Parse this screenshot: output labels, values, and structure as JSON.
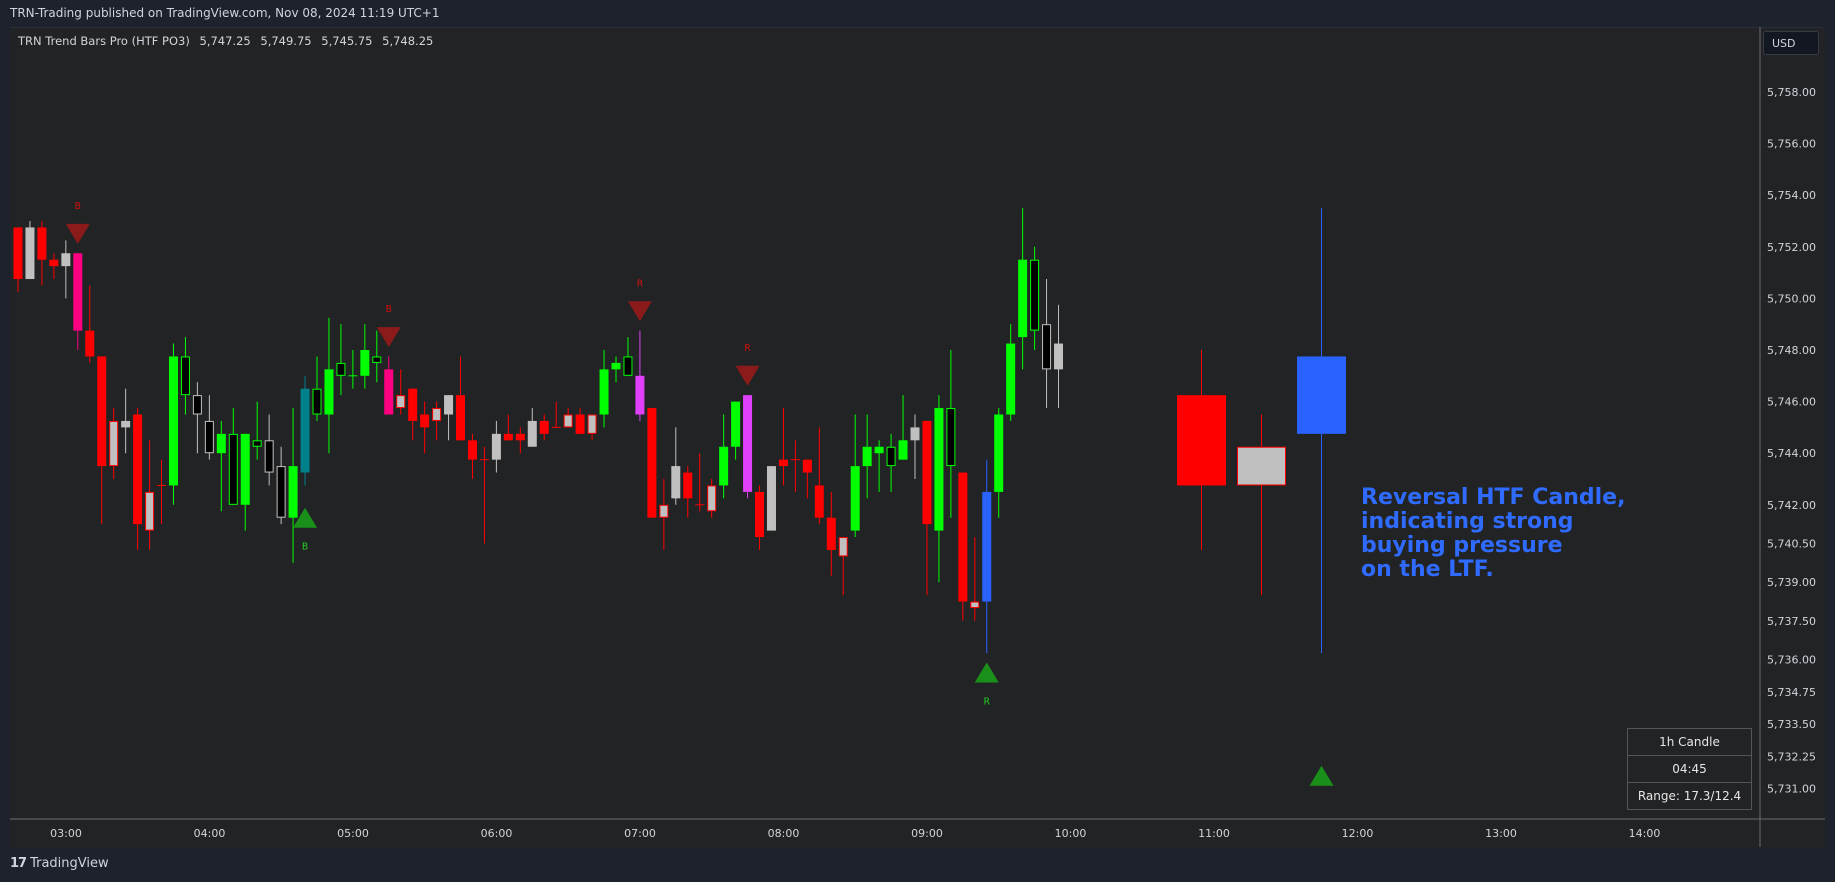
{
  "header": {
    "published": "TRN-Trading published on TradingView.com, Nov 08, 2024 11:19 UTC+1"
  },
  "legend": {
    "indicator": "TRN Trend Bars Pro (HTF PO3)",
    "values": [
      "5,747.25",
      "5,749.75",
      "5,745.75",
      "5,748.25"
    ]
  },
  "price_axis": {
    "currency": "USD",
    "ticks": [
      "5,758.00",
      "5,756.00",
      "5,754.00",
      "5,752.00",
      "5,750.00",
      "5,748.00",
      "5,746.00",
      "5,744.00",
      "5,742.00",
      "5,740.50",
      "5,739.00",
      "5,737.50",
      "5,736.00",
      "5,734.75",
      "5,733.50",
      "5,732.25",
      "5,731.00"
    ]
  },
  "time_axis": {
    "ticks": [
      "03:00",
      "04:00",
      "05:00",
      "06:00",
      "07:00",
      "08:00",
      "09:00",
      "10:00",
      "11:00",
      "12:00",
      "13:00",
      "14:00"
    ]
  },
  "colors": {
    "red": "#ff0000",
    "green": "#00ff00",
    "gray": "#c0c0c0",
    "pink": "#ff0080",
    "magenta": "#e040fb",
    "teal": "#00808a",
    "blue": "#2962ff",
    "signal_down": "#8b1a1a",
    "signal_up": "#1a8f1a",
    "label_down": "#cc1111",
    "label_up": "#22cc22",
    "annotation": "#2f6bff"
  },
  "chart_data": {
    "type": "candlestick",
    "title": "TRN Trend Bars Pro (HTF PO3)",
    "ylim": [
      5730.5,
      5758.5
    ],
    "x_ticks": [
      "03:00",
      "04:00",
      "05:00",
      "06:00",
      "07:00",
      "08:00",
      "09:00",
      "10:00",
      "11:00",
      "12:00",
      "13:00",
      "14:00"
    ],
    "candles": [
      {
        "o": 5752.75,
        "h": 5752.75,
        "l": 5750.25,
        "c": 5750.75,
        "s": "red"
      },
      {
        "o": 5750.75,
        "h": 5753.0,
        "l": 5750.75,
        "c": 5752.75,
        "s": "gray"
      },
      {
        "o": 5752.75,
        "h": 5753.0,
        "l": 5750.5,
        "c": 5751.5,
        "s": "red"
      },
      {
        "o": 5751.5,
        "h": 5751.75,
        "l": 5750.75,
        "c": 5751.25,
        "s": "red"
      },
      {
        "o": 5751.25,
        "h": 5752.25,
        "l": 5750.0,
        "c": 5751.75,
        "s": "gray"
      },
      {
        "o": 5751.75,
        "h": 5751.75,
        "l": 5748.0,
        "c": 5748.75,
        "s": "pink"
      },
      {
        "o": 5748.75,
        "h": 5750.5,
        "l": 5747.5,
        "c": 5747.75,
        "s": "red"
      },
      {
        "o": 5747.75,
        "h": 5747.75,
        "l": 5741.25,
        "c": 5743.5,
        "s": "red"
      },
      {
        "o": 5743.5,
        "h": 5745.75,
        "l": 5743.0,
        "c": 5745.25,
        "s": "gray-r"
      },
      {
        "o": 5745.0,
        "h": 5746.5,
        "l": 5744.0,
        "c": 5745.25,
        "s": "gray"
      },
      {
        "o": 5745.5,
        "h": 5745.75,
        "l": 5740.25,
        "c": 5741.25,
        "s": "red"
      },
      {
        "o": 5741.0,
        "h": 5744.5,
        "l": 5740.25,
        "c": 5742.5,
        "s": "gray-r"
      },
      {
        "o": 5742.75,
        "h": 5743.75,
        "l": 5741.25,
        "c": 5742.75,
        "s": "red"
      },
      {
        "o": 5742.75,
        "h": 5748.25,
        "l": 5742.0,
        "c": 5747.75,
        "s": "green"
      },
      {
        "o": 5747.75,
        "h": 5748.5,
        "l": 5745.5,
        "c": 5746.25,
        "s": "hollow-g"
      },
      {
        "o": 5746.25,
        "h": 5746.75,
        "l": 5744.0,
        "c": 5745.5,
        "s": "hollow-w"
      },
      {
        "o": 5745.25,
        "h": 5746.25,
        "l": 5743.75,
        "c": 5744.0,
        "s": "hollow-w"
      },
      {
        "o": 5744.0,
        "h": 5745.25,
        "l": 5741.75,
        "c": 5744.75,
        "s": "green"
      },
      {
        "o": 5744.75,
        "h": 5745.75,
        "l": 5742.0,
        "c": 5742.0,
        "s": "hollow-g"
      },
      {
        "o": 5742.0,
        "h": 5744.75,
        "l": 5741.0,
        "c": 5744.75,
        "s": "green"
      },
      {
        "o": 5744.5,
        "h": 5746.0,
        "l": 5743.75,
        "c": 5744.25,
        "s": "hollow-g"
      },
      {
        "o": 5744.5,
        "h": 5745.5,
        "l": 5742.75,
        "c": 5743.25,
        "s": "hollow-w"
      },
      {
        "o": 5743.5,
        "h": 5744.25,
        "l": 5741.25,
        "c": 5741.5,
        "s": "hollow-w"
      },
      {
        "o": 5741.5,
        "h": 5745.75,
        "l": 5739.75,
        "c": 5743.5,
        "s": "green"
      },
      {
        "o": 5743.25,
        "h": 5747.0,
        "l": 5742.75,
        "c": 5746.5,
        "s": "teal"
      },
      {
        "o": 5746.5,
        "h": 5747.75,
        "l": 5745.25,
        "c": 5745.5,
        "s": "hollow-g"
      },
      {
        "o": 5745.5,
        "h": 5749.25,
        "l": 5744.0,
        "c": 5747.25,
        "s": "green"
      },
      {
        "o": 5747.5,
        "h": 5749.0,
        "l": 5746.25,
        "c": 5747.0,
        "s": "hollow-g"
      },
      {
        "o": 5747.0,
        "h": 5748.0,
        "l": 5746.5,
        "c": 5747.0,
        "s": "green"
      },
      {
        "o": 5747.0,
        "h": 5749.0,
        "l": 5746.5,
        "c": 5748.0,
        "s": "green"
      },
      {
        "o": 5747.75,
        "h": 5748.75,
        "l": 5746.75,
        "c": 5747.5,
        "s": "hollow-g"
      },
      {
        "o": 5747.25,
        "h": 5747.75,
        "l": 5745.5,
        "c": 5745.5,
        "s": "pink"
      },
      {
        "o": 5745.75,
        "h": 5747.25,
        "l": 5745.5,
        "c": 5746.25,
        "s": "gray-r"
      },
      {
        "o": 5746.5,
        "h": 5746.5,
        "l": 5744.5,
        "c": 5745.25,
        "s": "red"
      },
      {
        "o": 5745.5,
        "h": 5746.0,
        "l": 5744.0,
        "c": 5745.0,
        "s": "red"
      },
      {
        "o": 5745.25,
        "h": 5746.0,
        "l": 5744.5,
        "c": 5745.75,
        "s": "gray-r"
      },
      {
        "o": 5745.5,
        "h": 5746.25,
        "l": 5744.5,
        "c": 5746.25,
        "s": "gray"
      },
      {
        "o": 5746.25,
        "h": 5747.75,
        "l": 5744.5,
        "c": 5744.5,
        "s": "red"
      },
      {
        "o": 5744.5,
        "h": 5744.75,
        "l": 5743.0,
        "c": 5743.75,
        "s": "red"
      },
      {
        "o": 5743.75,
        "h": 5744.25,
        "l": 5740.5,
        "c": 5743.75,
        "s": "red"
      },
      {
        "o": 5743.75,
        "h": 5745.25,
        "l": 5743.25,
        "c": 5744.75,
        "s": "gray"
      },
      {
        "o": 5744.75,
        "h": 5745.5,
        "l": 5744.5,
        "c": 5744.5,
        "s": "red"
      },
      {
        "o": 5744.75,
        "h": 5745.0,
        "l": 5744.0,
        "c": 5744.5,
        "s": "red"
      },
      {
        "o": 5744.25,
        "h": 5745.75,
        "l": 5744.25,
        "c": 5745.25,
        "s": "gray"
      },
      {
        "o": 5745.25,
        "h": 5745.5,
        "l": 5744.5,
        "c": 5744.75,
        "s": "red"
      },
      {
        "o": 5745.0,
        "h": 5746.0,
        "l": 5745.0,
        "c": 5745.0,
        "s": "red"
      },
      {
        "o": 5745.0,
        "h": 5745.75,
        "l": 5745.0,
        "c": 5745.5,
        "s": "gray-r"
      },
      {
        "o": 5745.5,
        "h": 5745.75,
        "l": 5744.75,
        "c": 5744.75,
        "s": "red"
      },
      {
        "o": 5744.75,
        "h": 5745.5,
        "l": 5744.5,
        "c": 5745.5,
        "s": "gray-r"
      },
      {
        "o": 5745.5,
        "h": 5748.0,
        "l": 5745.0,
        "c": 5747.25,
        "s": "green"
      },
      {
        "o": 5747.25,
        "h": 5747.75,
        "l": 5746.75,
        "c": 5747.5,
        "s": "green"
      },
      {
        "o": 5747.75,
        "h": 5748.5,
        "l": 5747.0,
        "c": 5747.0,
        "s": "hollow-g"
      },
      {
        "o": 5747.0,
        "h": 5748.75,
        "l": 5745.25,
        "c": 5745.5,
        "s": "magenta"
      },
      {
        "o": 5745.75,
        "h": 5745.75,
        "l": 5741.5,
        "c": 5741.5,
        "s": "red"
      },
      {
        "o": 5741.5,
        "h": 5743.0,
        "l": 5740.25,
        "c": 5742.0,
        "s": "gray-r"
      },
      {
        "o": 5742.25,
        "h": 5745.0,
        "l": 5742.0,
        "c": 5743.5,
        "s": "gray"
      },
      {
        "o": 5743.25,
        "h": 5743.5,
        "l": 5741.5,
        "c": 5742.25,
        "s": "red"
      },
      {
        "o": 5742.0,
        "h": 5744.0,
        "l": 5741.75,
        "c": 5742.0,
        "s": "red"
      },
      {
        "o": 5741.75,
        "h": 5743.0,
        "l": 5741.5,
        "c": 5742.75,
        "s": "gray-r"
      },
      {
        "o": 5742.75,
        "h": 5745.5,
        "l": 5742.25,
        "c": 5744.25,
        "s": "green"
      },
      {
        "o": 5744.25,
        "h": 5746.0,
        "l": 5743.75,
        "c": 5746.0,
        "s": "green"
      },
      {
        "o": 5746.25,
        "h": 5746.25,
        "l": 5742.25,
        "c": 5742.5,
        "s": "magenta"
      },
      {
        "o": 5742.5,
        "h": 5742.75,
        "l": 5740.25,
        "c": 5740.75,
        "s": "red"
      },
      {
        "o": 5741.0,
        "h": 5743.5,
        "l": 5741.0,
        "c": 5743.5,
        "s": "gray"
      },
      {
        "o": 5743.75,
        "h": 5745.75,
        "l": 5742.75,
        "c": 5743.5,
        "s": "red"
      },
      {
        "o": 5743.75,
        "h": 5744.5,
        "l": 5742.5,
        "c": 5743.75,
        "s": "red"
      },
      {
        "o": 5743.75,
        "h": 5743.75,
        "l": 5742.25,
        "c": 5743.25,
        "s": "red"
      },
      {
        "o": 5742.75,
        "h": 5745.0,
        "l": 5741.25,
        "c": 5741.5,
        "s": "red"
      },
      {
        "o": 5741.5,
        "h": 5742.5,
        "l": 5739.25,
        "c": 5740.25,
        "s": "red"
      },
      {
        "o": 5740.0,
        "h": 5740.75,
        "l": 5738.5,
        "c": 5740.75,
        "s": "gray-r"
      },
      {
        "o": 5741.0,
        "h": 5745.5,
        "l": 5740.75,
        "c": 5743.5,
        "s": "green"
      },
      {
        "o": 5743.5,
        "h": 5745.5,
        "l": 5742.25,
        "c": 5744.25,
        "s": "green"
      },
      {
        "o": 5744.0,
        "h": 5744.5,
        "l": 5742.5,
        "c": 5744.25,
        "s": "green"
      },
      {
        "o": 5744.25,
        "h": 5744.75,
        "l": 5742.5,
        "c": 5743.5,
        "s": "hollow-g"
      },
      {
        "o": 5743.75,
        "h": 5746.25,
        "l": 5743.75,
        "c": 5744.5,
        "s": "green"
      },
      {
        "o": 5744.5,
        "h": 5745.5,
        "l": 5743.0,
        "c": 5745.0,
        "s": "gray"
      },
      {
        "o": 5745.25,
        "h": 5745.25,
        "l": 5738.5,
        "c": 5741.25,
        "s": "red"
      },
      {
        "o": 5741.0,
        "h": 5746.25,
        "l": 5739.0,
        "c": 5745.75,
        "s": "green"
      },
      {
        "o": 5745.75,
        "h": 5748.0,
        "l": 5741.5,
        "c": 5743.5,
        "s": "hollow-g"
      },
      {
        "o": 5743.25,
        "h": 5743.25,
        "l": 5737.5,
        "c": 5738.25,
        "s": "red"
      },
      {
        "o": 5738.0,
        "h": 5740.75,
        "l": 5737.5,
        "c": 5738.25,
        "s": "gray-r"
      },
      {
        "o": 5738.25,
        "h": 5743.75,
        "l": 5736.25,
        "c": 5742.5,
        "s": "blue"
      },
      {
        "o": 5742.5,
        "h": 5745.75,
        "l": 5741.5,
        "c": 5745.5,
        "s": "green"
      },
      {
        "o": 5745.5,
        "h": 5749.0,
        "l": 5745.25,
        "c": 5748.25,
        "s": "green"
      },
      {
        "o": 5748.5,
        "h": 5753.5,
        "l": 5747.25,
        "c": 5751.5,
        "s": "green"
      },
      {
        "o": 5751.5,
        "h": 5752.0,
        "l": 5748.0,
        "c": 5748.75,
        "s": "hollow-g"
      },
      {
        "o": 5749.0,
        "h": 5750.75,
        "l": 5745.75,
        "c": 5747.25,
        "s": "hollow-w"
      },
      {
        "o": 5747.25,
        "h": 5749.75,
        "l": 5745.75,
        "c": 5748.25,
        "s": "gray"
      }
    ],
    "signals": [
      {
        "bar": 5,
        "dir": "down",
        "label": "B",
        "price": 5752.5
      },
      {
        "bar": 24,
        "dir": "up",
        "label": "B",
        "price": 5741.5
      },
      {
        "bar": 31,
        "dir": "down",
        "label": "B",
        "price": 5748.5
      },
      {
        "bar": 52,
        "dir": "down",
        "label": "R",
        "price": 5749.5
      },
      {
        "bar": 61,
        "dir": "down",
        "label": "R",
        "price": 5747.0
      },
      {
        "bar": 81,
        "dir": "up",
        "label": "R",
        "price": 5735.5
      }
    ],
    "htf_candles": [
      {
        "o": 5746.25,
        "h": 5748.0,
        "l": 5740.25,
        "c": 5742.75,
        "s": "red"
      },
      {
        "o": 5742.75,
        "h": 5745.5,
        "l": 5738.5,
        "c": 5744.25,
        "s": "gray-r"
      },
      {
        "o": 5744.75,
        "h": 5753.5,
        "l": 5736.25,
        "c": 5747.75,
        "s": "blue"
      }
    ],
    "htf_signal": {
      "dir": "up",
      "price": 5731.5
    }
  },
  "annotation": {
    "text": "Reversal HTF Candle,\nindicating strong\nbuying pressure\non the LTF."
  },
  "info_box": {
    "title": "1h Candle",
    "countdown": "04:45",
    "range": "Range: 17.3/12.4"
  },
  "footer": {
    "logo_mark": "17",
    "brand": "TradingView"
  }
}
